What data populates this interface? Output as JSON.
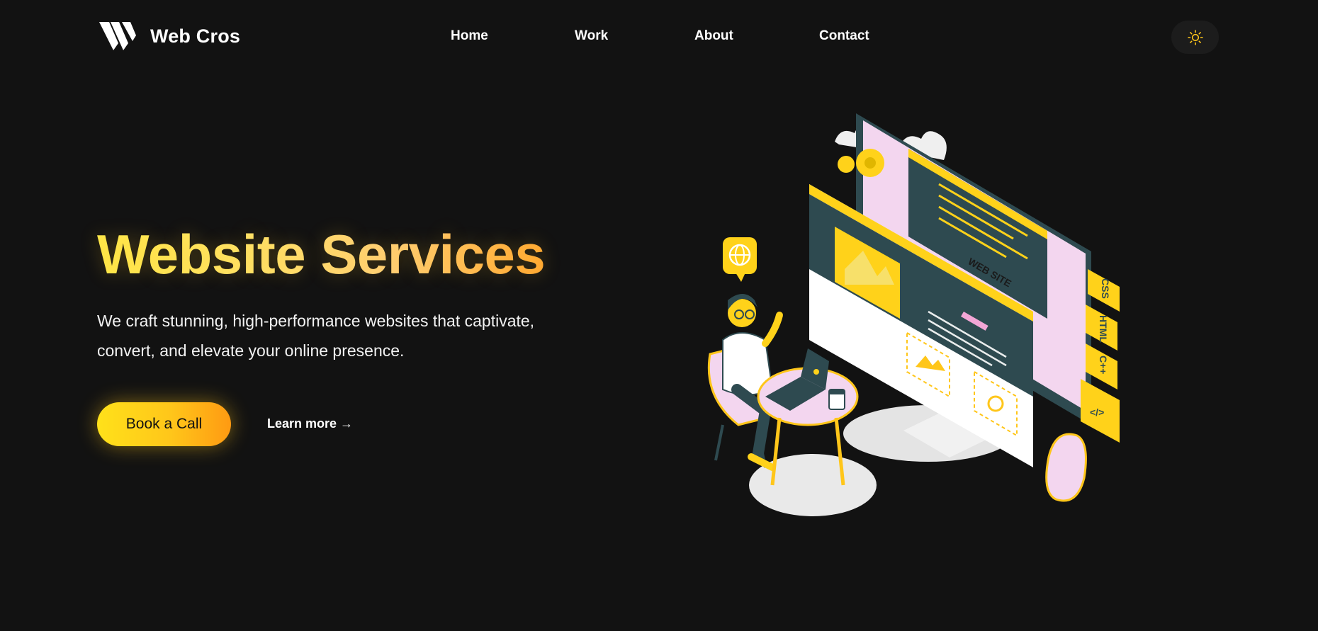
{
  "brand": {
    "name": "Web Cros",
    "logo_icon": "w-logo-icon"
  },
  "nav": {
    "items": [
      {
        "label": "Home"
      },
      {
        "label": "Work"
      },
      {
        "label": "About"
      },
      {
        "label": "Contact"
      }
    ]
  },
  "theme_toggle": {
    "icon": "sun-icon"
  },
  "hero": {
    "title": "Website Services",
    "subtitle": "We craft stunning, high-performance websites that captivate, convert, and elevate your online presence.",
    "primary_cta": "Book a Call",
    "secondary_cta": "Learn more →"
  },
  "illustration": {
    "chips": [
      "CSS",
      "HTML",
      "C++"
    ],
    "screen_label": "WEB SITE",
    "icons": [
      "gear-icon",
      "globe-icon",
      "code-icon",
      "image-icon",
      "cloud-icon"
    ]
  },
  "colors": {
    "background": "#121212",
    "accent_yellow": "#ffd21a",
    "accent_orange": "#ff9a12",
    "illustration_teal": "#2e4a50",
    "illustration_pink": "#f3d6ef"
  }
}
